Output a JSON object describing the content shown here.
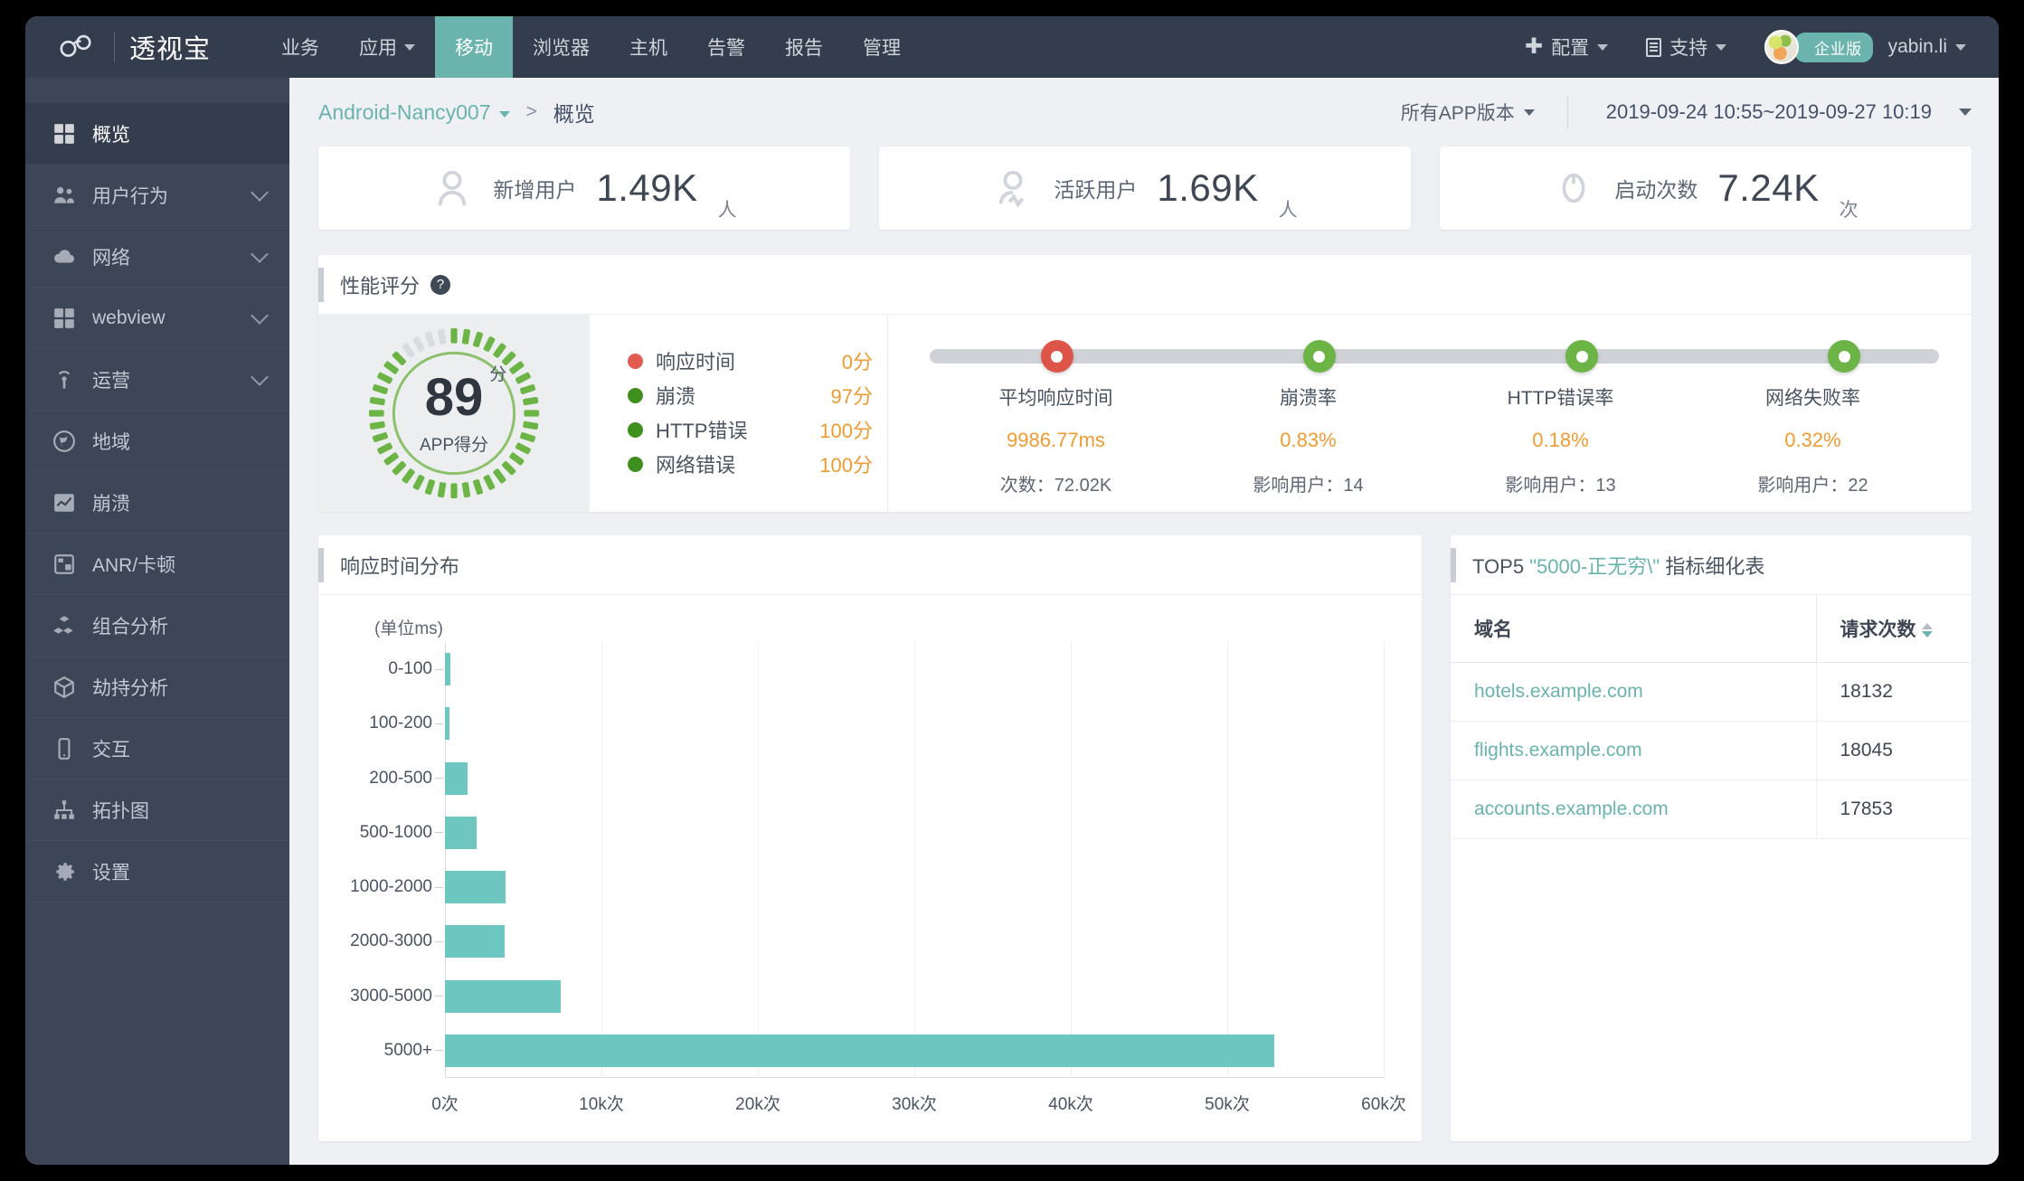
{
  "brand": {
    "name": "透视宝",
    "logo_icon": "infinity-cloud-logo"
  },
  "topnav": {
    "items": [
      {
        "label": "业务",
        "has_caret": false,
        "active": false
      },
      {
        "label": "应用",
        "has_caret": true,
        "active": false
      },
      {
        "label": "移动",
        "has_caret": false,
        "active": true
      },
      {
        "label": "浏览器",
        "has_caret": false,
        "active": false
      },
      {
        "label": "主机",
        "has_caret": false,
        "active": false
      },
      {
        "label": "告警",
        "has_caret": false,
        "active": false
      },
      {
        "label": "报告",
        "has_caret": false,
        "active": false
      },
      {
        "label": "管理",
        "has_caret": false,
        "active": false
      }
    ],
    "config_label": "配置",
    "support_label": "支持",
    "edition_badge": "企业版",
    "user_name": "yabin.li"
  },
  "sidebar": {
    "items": [
      {
        "label": "概览",
        "icon": "grid-icon",
        "active": true,
        "expandable": false
      },
      {
        "label": "用户行为",
        "icon": "users-icon",
        "active": false,
        "expandable": true
      },
      {
        "label": "网络",
        "icon": "cloud-icon",
        "active": false,
        "expandable": true
      },
      {
        "label": "webview",
        "icon": "grid-icon",
        "active": false,
        "expandable": true
      },
      {
        "label": "运营",
        "icon": "antenna-icon",
        "active": false,
        "expandable": true
      },
      {
        "label": "地域",
        "icon": "globe-icon",
        "active": false,
        "expandable": false
      },
      {
        "label": "崩溃",
        "icon": "chart-box-icon",
        "active": false,
        "expandable": false
      },
      {
        "label": "ANR/卡顿",
        "icon": "note-icon",
        "active": false,
        "expandable": false
      },
      {
        "label": "组合分析",
        "icon": "cubes-icon",
        "active": false,
        "expandable": false
      },
      {
        "label": "劫持分析",
        "icon": "box-icon",
        "active": false,
        "expandable": false
      },
      {
        "label": "交互",
        "icon": "phone-icon",
        "active": false,
        "expandable": false
      },
      {
        "label": "拓扑图",
        "icon": "sitemap-icon",
        "active": false,
        "expandable": false
      },
      {
        "label": "设置",
        "icon": "gear-icon",
        "active": false,
        "expandable": false
      }
    ]
  },
  "breadcrumb": {
    "app": "Android-Nancy007",
    "separator": ">",
    "current": "概览"
  },
  "filters": {
    "version": "所有APP版本",
    "date_range": "2019-09-24 10:55~2019-09-27 10:19"
  },
  "kpis": [
    {
      "icon": "user-icon",
      "label": "新增用户",
      "value": "1.49K",
      "unit": "人"
    },
    {
      "icon": "user-pulse-icon",
      "label": "活跃用户",
      "value": "1.69K",
      "unit": "人"
    },
    {
      "icon": "launch-icon",
      "label": "启动次数",
      "value": "7.24K",
      "unit": "次"
    }
  ],
  "performance": {
    "title": "性能评分",
    "help_icon": "question-icon",
    "gauge": {
      "score": "89",
      "score_unit": "分",
      "caption": "APP得分",
      "percent": 89,
      "color": "#6cb446"
    },
    "legend": [
      {
        "name": "响应时间",
        "value": "0分",
        "color": "#e15b50"
      },
      {
        "name": "崩溃",
        "value": "97分",
        "color": "#3f8f1e"
      },
      {
        "name": "HTTP错误",
        "value": "100分",
        "color": "#3f8f1e"
      },
      {
        "name": "网络错误",
        "value": "100分",
        "color": "#3f8f1e"
      }
    ],
    "metrics": [
      {
        "name": "平均响应时间",
        "value": "9986.77ms",
        "sub": "次数：72.02K",
        "dot_color": "#dd5549",
        "pos": 11
      },
      {
        "name": "崩溃率",
        "value": "0.83%",
        "sub": "影响用户：14",
        "dot_color": "#6cb446",
        "pos": 37
      },
      {
        "name": "HTTP错误率",
        "value": "0.18%",
        "sub": "影响用户：13",
        "dot_color": "#6cb446",
        "pos": 63
      },
      {
        "name": "网络失败率",
        "value": "0.32%",
        "sub": "影响用户：22",
        "dot_color": "#6cb446",
        "pos": 89
      }
    ]
  },
  "chart_data": {
    "type": "bar",
    "orientation": "horizontal",
    "title": "响应时间分布",
    "unit_note": "(单位ms)",
    "xlabel": "",
    "ylabel": "",
    "grid": true,
    "bar_color": "#6ec6c0",
    "categories": [
      "0-100",
      "100-200",
      "200-500",
      "500-1000",
      "1000-2000",
      "2000-3000",
      "3000-5000",
      "5000+"
    ],
    "values": [
      320,
      300,
      1450,
      2050,
      3850,
      3800,
      7400,
      53000
    ],
    "xticks": [
      "0次",
      "10k次",
      "20k次",
      "30k次",
      "40k次",
      "50k次",
      "60k次"
    ],
    "xtick_values": [
      0,
      10000,
      20000,
      30000,
      40000,
      50000,
      60000
    ],
    "xlim": [
      0,
      60000
    ]
  },
  "top_table": {
    "title_prefix": "TOP5",
    "title_highlight": "\"5000-正无穷\\\"",
    "title_suffix": "指标细化表",
    "columns": [
      "域名",
      "请求次数"
    ],
    "sort_icon": "sort-icon",
    "rows": [
      {
        "domain": "hotels.example.com",
        "requests": "18132"
      },
      {
        "domain": "flights.example.com",
        "requests": "18045"
      },
      {
        "domain": "accounts.example.com",
        "requests": "17853"
      }
    ]
  }
}
